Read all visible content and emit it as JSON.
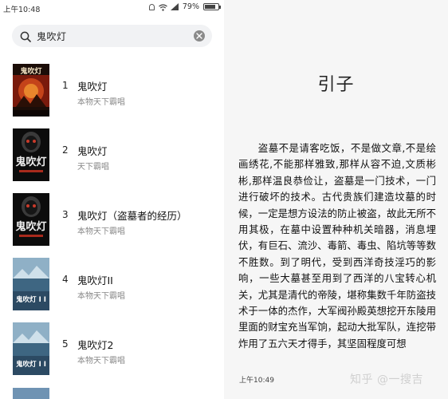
{
  "status_bar": {
    "time": "上午10:48",
    "battery": "79%",
    "battery_level": 0.79
  },
  "search": {
    "query": "鬼吹灯"
  },
  "results": [
    {
      "index": "1",
      "title": "鬼吹灯",
      "author": "本物天下霸唱"
    },
    {
      "index": "2",
      "title": "鬼吹灯",
      "author": "天下霸唱"
    },
    {
      "index": "3",
      "title": "鬼吹灯（盗墓者的经历）",
      "author": "本物天下霸唱"
    },
    {
      "index": "4",
      "title": "鬼吹灯II",
      "author": "本物天下霸唱"
    },
    {
      "index": "5",
      "title": "鬼吹灯2",
      "author": "本物天下霸唱"
    }
  ],
  "covers": [
    {
      "text": "鬼吹灯"
    },
    {
      "text": "鬼吹灯"
    },
    {
      "text": "鬼吹灯"
    },
    {
      "text": "鬼吹灯 I I"
    },
    {
      "text": "鬼吹灯 I I"
    }
  ],
  "reader": {
    "chapter_title": "引子",
    "body": "盗墓不是请客吃饭，不是做文章,不是绘画绣花,不能那样雅致,那样从容不迫,文质彬彬,那样温良恭俭让，盗墓是一门技术，一门进行破坏的技术。古代贵族们建造坟墓的时候，一定是想方设法的防止被盗，故此无所不用其极，在墓中设置种种机关暗器，消息埋伏，有巨石、流沙、毒箭、毒虫、陷坑等等数不胜数。到了明代，受到西洋奇技淫巧的影响，一些大墓甚至用到了西洋的八宝转心机关，尤其是清代的帝陵，堪称集数千年防盗技术于一体的杰作，大军阀孙殿英想挖开东陵用里面的财宝充当军饷，起动大批军队，连挖带炸用了五六天才得手，其坚固程度可想",
    "time": "上午10:49",
    "watermark": "知乎 @一搜吉"
  },
  "colors": {
    "reader_bg": "#f6f6f6",
    "search_bg": "#f1f2f4",
    "muted_text": "#888888"
  }
}
